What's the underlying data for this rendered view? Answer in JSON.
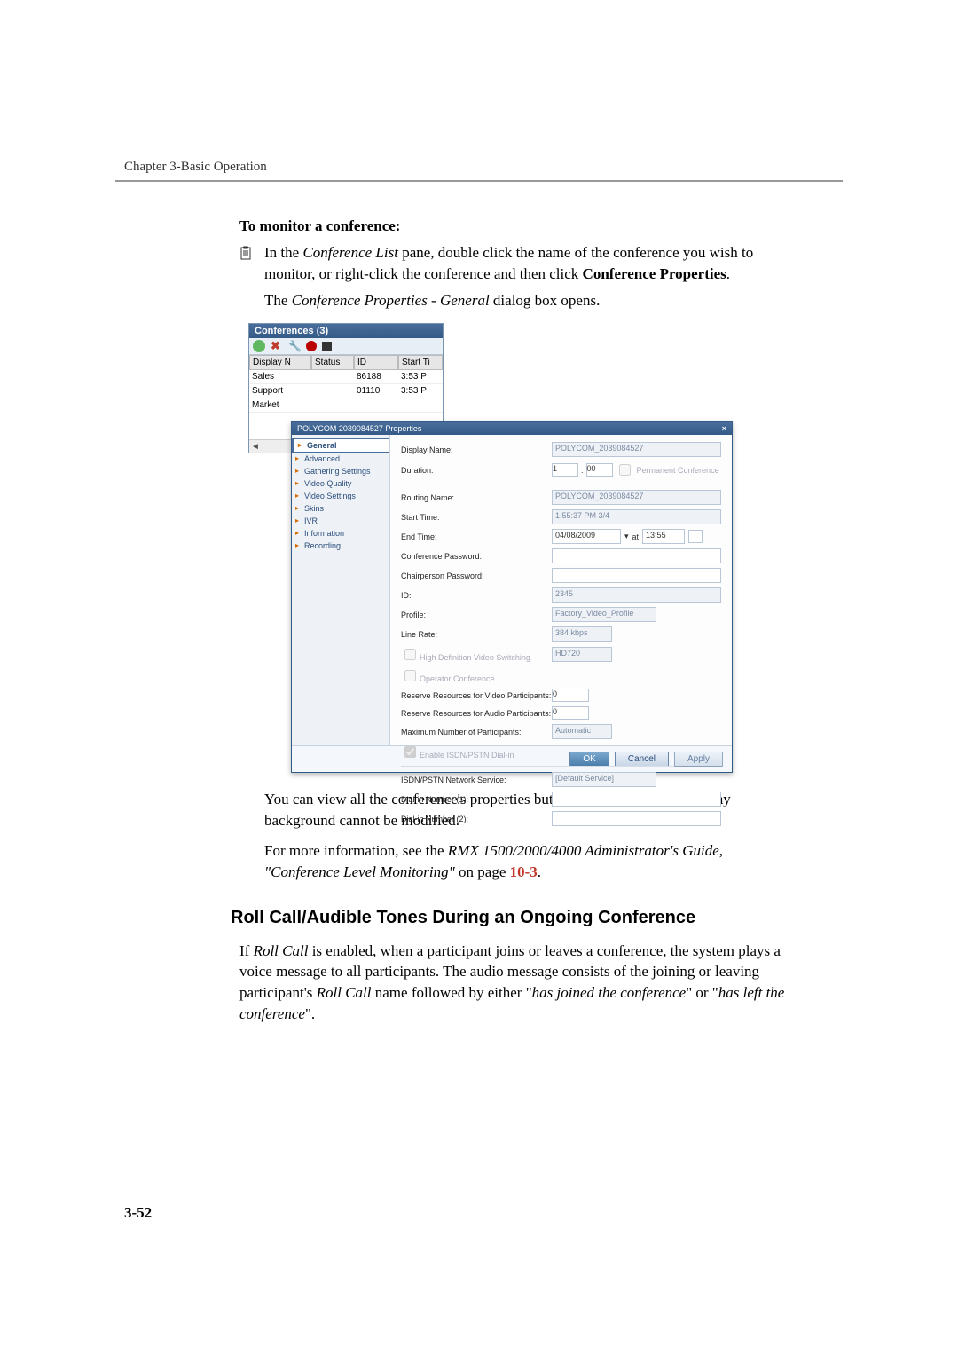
{
  "chapter_header": "Chapter 3-Basic Operation",
  "subhead1": "To monitor a conference:",
  "hang_text": {
    "prefix": "In the ",
    "conf_list": "Conference List",
    "mid": " pane, double click the name of the conference you wish to monitor, or right-click the conference and then click ",
    "conf_props": "Conference Properties",
    "period": "."
  },
  "line2a": "The ",
  "line2b": "Conference Properties - General",
  "line2c": " dialog box opens.",
  "after_shot_p1": "You can view all the conference's properties but those that appear with a gray background cannot be modified.",
  "after_shot_p2a": "For more information, see the ",
  "after_shot_p2b": "RMX 1500/2000/4000 Administrator's Guide, \"Conference Level Monitoring\"",
  "after_shot_p2c": " on page ",
  "after_shot_link": "10-3",
  "after_shot_p2d": ".",
  "h2": "Roll Call/Audible Tones During an Ongoing Conference",
  "p3a": "If ",
  "p3b": "Roll Call",
  "p3c": " is enabled, when a participant joins or leaves a conference, the system plays a voice message to all participants. The audio message consists of the joining or leaving participant's ",
  "p3d": "Roll Call",
  "p3e": " name followed by either \"",
  "p3f": "has joined the conference",
  "p3g": "\" or \"",
  "p3h": "has left the conference",
  "p3i": "\".",
  "page_num": "3-52",
  "conf_pane": {
    "title": "Conferences (3)",
    "cols": [
      "Display N",
      "Status",
      "ID",
      "Start Ti"
    ],
    "rows": [
      {
        "name": "Sales",
        "status": "",
        "id": "86188",
        "time": "3:53 P"
      },
      {
        "name": "Support",
        "status": "",
        "id": "01110",
        "time": "3:53 P"
      },
      {
        "name": "Market",
        "status": "",
        "id": "",
        "time": ""
      }
    ]
  },
  "props": {
    "title": "POLYCOM 2039084527 Properties",
    "nav": [
      "General",
      "Advanced",
      "Gathering Settings",
      "Video Quality",
      "Video Settings",
      "Skins",
      "IVR",
      "Information",
      "Recording"
    ],
    "fields": {
      "display_name": {
        "lbl": "Display Name:",
        "val": "POLYCOM_2039084527"
      },
      "duration": {
        "lbl": "Duration:",
        "h": "1",
        "m": "00",
        "perm": "Permanent Conference"
      },
      "routing_name": {
        "lbl": "Routing Name:",
        "val": "POLYCOM_2039084527"
      },
      "start_time": {
        "lbl": "Start Time:",
        "val": "1:55:37 PM 3/4"
      },
      "end_time": {
        "lbl": "End Time:",
        "date": "04/08/2009",
        "time": "13:55"
      },
      "conf_pwd": {
        "lbl": "Conference Password:",
        "val": ""
      },
      "chair_pwd": {
        "lbl": "Chairperson Password:",
        "val": ""
      },
      "id": {
        "lbl": "ID:",
        "val": "2345"
      },
      "profile": {
        "lbl": "Profile:",
        "val": "Factory_Video_Profile"
      },
      "line_rate": {
        "lbl": "Line Rate:",
        "val": "384 kbps"
      },
      "hd_switch": {
        "lbl": "High Definition Video Switching",
        "val": "HD720"
      },
      "op_conf": {
        "lbl": "Operator Conference"
      },
      "res_video": {
        "lbl": "Reserve Resources for Video Participants:",
        "val": "0"
      },
      "res_audio": {
        "lbl": "Reserve Resources for Audio Participants:",
        "val": "0"
      },
      "max_part": {
        "lbl": "Maximum Number of Participants:",
        "val": "Automatic"
      },
      "en_isdn": {
        "lbl": "Enable ISDN/PSTN Dial-in"
      },
      "isdn_svc": {
        "lbl": "ISDN/PSTN Network Service:",
        "val": "[Default Service]"
      },
      "dial1": {
        "lbl": "Dial-in Number (1):",
        "val": ""
      },
      "dial2": {
        "lbl": "Dial-in Number (2):",
        "val": ""
      }
    },
    "buttons": {
      "ok": "OK",
      "cancel": "Cancel",
      "apply": "Apply"
    }
  }
}
